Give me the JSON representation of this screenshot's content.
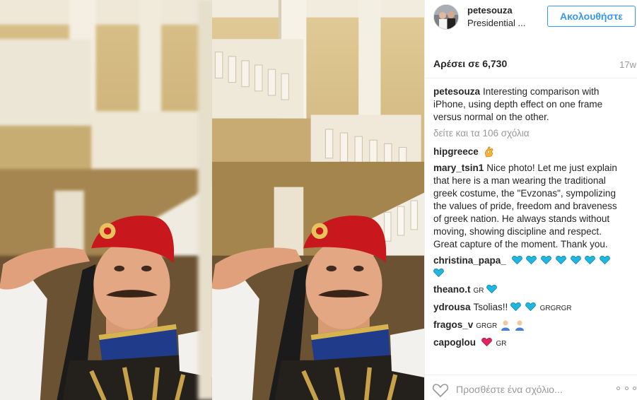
{
  "post": {
    "username": "petesouza",
    "location": "Presidential ...",
    "follow_label": "Ακολουθήστε",
    "likes": "Αρέσει σε 6,730",
    "time_ago": "17w"
  },
  "caption": {
    "user": "petesouza",
    "text": "Interesting comparison with iPhone, using depth effect on one frame versus normal on the other."
  },
  "view_all_comments": "δείτε και τα 106 σχόλια",
  "comments": [
    {
      "user": "hipgreece",
      "text": ""
    },
    {
      "user": "mary_tsin1",
      "text": "Nice photo! Let me just explain that here is a man wearing the traditional greek costume, the \"Evzonas\", sympolizing the values of pride, freedom and braveness of greek nation. He always stands without moving, showing discipline and respect. Great capture of the moment. Thank you."
    },
    {
      "user": "christina_papa_",
      "text": ""
    },
    {
      "user": "theano.t",
      "text": "GR"
    },
    {
      "user": "ydrousa",
      "text": "Tsolias!!",
      "text2": "GRGRGR"
    },
    {
      "user": "fragos_v",
      "text": "GRGR"
    },
    {
      "user": "capoglou",
      "text": "GR"
    }
  ],
  "comment_box": {
    "placeholder": "Προσθέστε ένα σχόλιο..."
  },
  "colors": {
    "accent": "#3897f0",
    "blue_heart": "#1fb6e0",
    "red_heart": "#e0245e"
  },
  "icons": [
    "like-heart-icon",
    "more-options-icon",
    "ok-hand-emoji-icon",
    "blue-heart-emoji-icon",
    "red-heart-emoji-icon",
    "greek-flag-text"
  ]
}
